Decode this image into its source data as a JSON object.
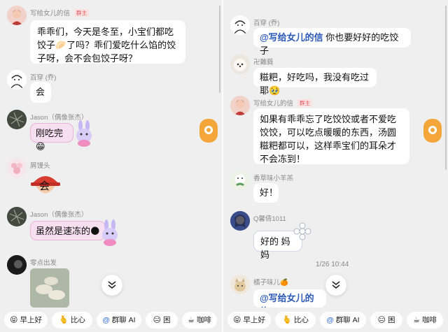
{
  "left": {
    "messages": [
      {
        "sender": "写给女儿的信",
        "badge": "群主",
        "text": "乖乖们，今天是冬至，小宝们都吃饺子🥟了吗？乖们爱吃什么馅的饺子呀，会不会包饺子呀？"
      },
      {
        "sender": "百穿 (乔)",
        "text": "会"
      },
      {
        "sender": "Jason（偶像张杰）",
        "text": "刚吃完😁"
      },
      {
        "sender": "屑馒头",
        "text": "会"
      },
      {
        "sender": "Jason（偶像张杰）",
        "text": "虽然是速冻的🌑"
      },
      {
        "sender": "零点出发"
      }
    ]
  },
  "right": {
    "messages": [
      {
        "sender": "百穿 (乔)",
        "mention": "@写给女儿的信",
        "text": " 你也要好好的吃饺子"
      },
      {
        "sender": "卍難蕤",
        "text": "糍粑，好吃吗，我没有吃过耶🥹"
      },
      {
        "sender": "写给女儿的信",
        "badge": "群主",
        "text": "如果有乖乖忘了吃饺饺或者不爱吃饺饺，可以吃点暖暖的东西，汤圆糍粑都可以，这样乖宝们的耳朵才不会冻到！"
      },
      {
        "sender": "香草味小羊羔",
        "text": "好！"
      },
      {
        "sender": "Q馨倩1011",
        "text": "好的 妈妈"
      },
      {
        "sender": "橘子味儿🍊",
        "mention": "@写给女儿的信"
      }
    ],
    "timestamp": "1/26 10:44"
  },
  "quick_replies": [
    {
      "icon": "😝",
      "label": "早上好"
    },
    {
      "icon": "🫰",
      "label": "比心"
    },
    {
      "icon": "@",
      "label": "群聊 AI"
    },
    {
      "icon": "😑",
      "label": "困"
    },
    {
      "icon": "☕",
      "label": "咖啡"
    }
  ],
  "colors": {
    "mention": "#2a58b6",
    "owner_badge": "#e0505a",
    "highlight_bubble": "#f6dff0",
    "float_icon": "#f4a63a"
  }
}
